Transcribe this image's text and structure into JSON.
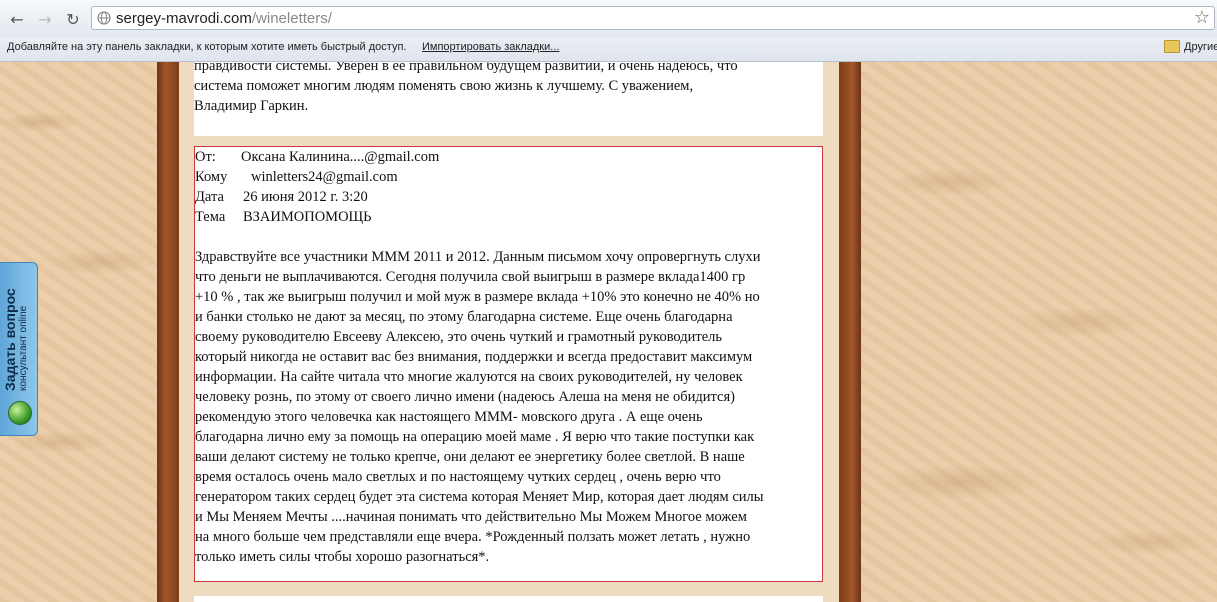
{
  "browser": {
    "url_host": "sergey-mavrodi.com",
    "url_path": "/wineletters/",
    "bookmarks_bar": {
      "message": "Добавляйте на эту панель закладки, к которым хотите иметь быстрый доступ.",
      "import_link": "Импортировать закладки...",
      "other_bookmarks": "Другие"
    }
  },
  "previous_letter": {
    "lines": [
      "правдивости системы. Уверен в её правильном будущем развитии, и очень надеюсь, что",
      "система поможет многим людям поменять свою жизнь к лучшему.   С уважением,",
      "Владимир Гаркин."
    ]
  },
  "letter": {
    "from_label": "От:",
    "from_value": "Оксана Калинина....@gmail.com",
    "to_label": "Кому",
    "to_value": "winletters24@gmail.com",
    "date_label": "Дата",
    "date_value": "26 июня 2012 г. 3:20",
    "subject_label": "Тема",
    "subject_value": "ВЗАИМОПОМОЩЬ",
    "body_lines": [
      "Здравствуйте все участники МММ 2011 и 2012. Данным письмом хочу опровергнуть слухи",
      "что деньги не выплачиваются. Сегодня получила свой выигрыш в размере вклада1400 гр",
      "+10 % , так же выигрыш получил и мой муж в размере вклада +10% это конечно не 40% но",
      "и банки столько не дают за месяц, по этому благодарна системе. Еще очень благодарна",
      "своему руководителю Евсееву Алексею, это очень чуткий и грамотный руководитель",
      "который никогда не оставит вас без внимания, поддержки и всегда предоставит максимум",
      "информации. На сайте читала что многие жалуются на своих руководителей, ну человек",
      "человеку рознь, по этому от своего лично имени (надеюсь Алеша на меня не обидится)",
      "рекомендую этого человечка как настоящего МММ- мовского друга . А еще очень",
      "благодарна лично ему за помощь на операцию моей маме . Я верю что такие поступки как",
      "ваши делают систему не только крепче, они делают ее энергетику более светлой. В наше",
      "время осталось очень мало светлых и по настоящему чутких сердец , очень верю что",
      "генератором таких сердец будет эта система которая Меняет Мир, которая дает людям силы",
      "и Мы Меняем Мечты ....начиная понимать что действительно Мы Можем Многое можем",
      "на много больше чем представляли еще вчера. *Рожденный ползать может летать , нужно",
      "только иметь силы чтобы хорошо разогнаться*."
    ]
  },
  "widget": {
    "title": "Задать вопрос",
    "subtitle": "консультант online"
  },
  "icons": {
    "back": "back-arrow-icon",
    "forward": "forward-arrow-icon",
    "reload": "reload-icon",
    "star": "star-icon",
    "folder": "folder-icon",
    "globe": "globe-icon"
  }
}
